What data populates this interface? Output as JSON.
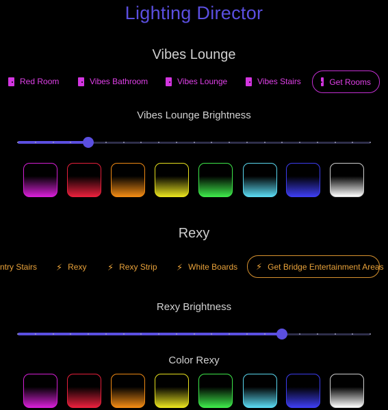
{
  "app": {
    "title": "Lighting Director"
  },
  "room1": {
    "title": "Vibes Lounge",
    "chips": [
      {
        "label": "Red Room",
        "icon": "door-icon"
      },
      {
        "label": "Vibes Bathroom",
        "icon": "door-icon"
      },
      {
        "label": "Vibes Lounge",
        "icon": "door-icon"
      },
      {
        "label": "Vibes Stairs",
        "icon": "door-icon"
      },
      {
        "label": "Get Rooms",
        "icon": "door-icon"
      }
    ],
    "brightness_label": "Vibes Lounge Brightness",
    "brightness": 0.2
  },
  "room2": {
    "title": "Rexy",
    "chips": [
      {
        "label": "ntry Stairs",
        "icon": "bolt-icon"
      },
      {
        "label": "Rexy",
        "icon": "bolt-icon"
      },
      {
        "label": "Rexy Strip",
        "icon": "bolt-icon"
      },
      {
        "label": "White Boards",
        "icon": "bolt-icon"
      },
      {
        "label": "Get Bridge Entertainment Areas",
        "icon": "bolt-icon"
      }
    ],
    "brightness_label": "Rexy Brightness",
    "brightness": 0.75,
    "color_label": "Color Rexy"
  },
  "colors": {
    "accent": "#5b4fe0",
    "room_chip": "#e040e8",
    "light_chip": "#e9a23a",
    "swatches": [
      "#d61fd6",
      "#e8203c",
      "#f08a14",
      "#e8e21e",
      "#3ee84a",
      "#5ad8f0",
      "#3d3df0",
      "#ffffff"
    ]
  }
}
